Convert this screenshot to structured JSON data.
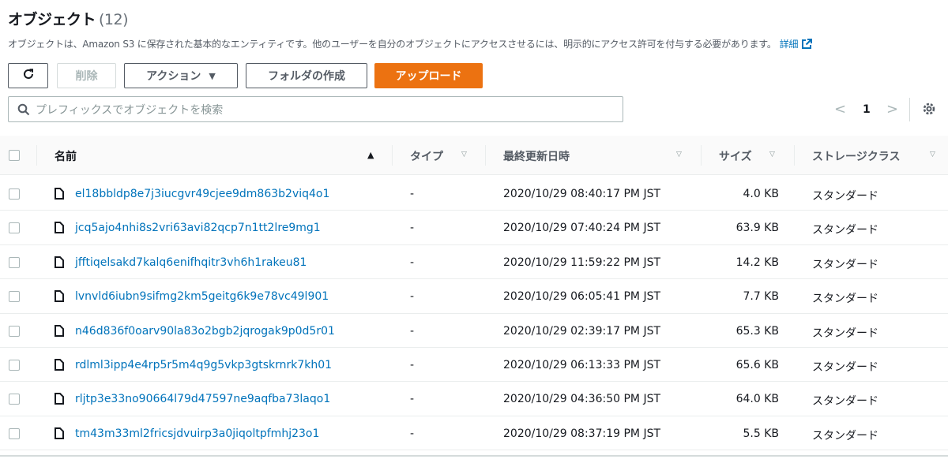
{
  "header": {
    "title": "オブジェクト",
    "count": "(12)",
    "description": "オブジェクトは、Amazon S3 に保存された基本的なエンティティです。他のユーザーを自分のオブジェクトにアクセスさせるには、明示的にアクセス許可を付与する必要があります。",
    "details_link": "詳細"
  },
  "toolbar": {
    "refresh_icon": "refresh-icon",
    "delete_label": "削除",
    "actions_label": "アクション",
    "create_folder_label": "フォルダの作成",
    "upload_label": "アップロード"
  },
  "search": {
    "placeholder": "プレフィックスでオブジェクトを検索"
  },
  "pagination": {
    "page": "1"
  },
  "table": {
    "columns": {
      "name": "名前",
      "type": "タイプ",
      "modified": "最終更新日時",
      "size": "サイズ",
      "storage_class": "ストレージクラス"
    },
    "rows": [
      {
        "name": "el18bbldp8e7j3iucgvr49cjee9dm863b2viq4o1",
        "type": "-",
        "modified": "2020/10/29 08:40:17 PM JST",
        "size": "4.0 KB",
        "storage_class": "スタンダード"
      },
      {
        "name": "jcq5ajo4nhi8s2vri63avi82qcp7n1tt2lre9mg1",
        "type": "-",
        "modified": "2020/10/29 07:40:24 PM JST",
        "size": "63.9 KB",
        "storage_class": "スタンダード"
      },
      {
        "name": "jfftiqelsakd7kalq6enifhqitr3vh6h1rakeu81",
        "type": "-",
        "modified": "2020/10/29 11:59:22 PM JST",
        "size": "14.2 KB",
        "storage_class": "スタンダード"
      },
      {
        "name": "lvnvld6iubn9sifmg2km5geitg6k9e78vc49l901",
        "type": "-",
        "modified": "2020/10/29 06:05:41 PM JST",
        "size": "7.7 KB",
        "storage_class": "スタンダード"
      },
      {
        "name": "n46d836f0oarv90la83o2bgb2jqrogak9p0d5r01",
        "type": "-",
        "modified": "2020/10/29 02:39:17 PM JST",
        "size": "65.3 KB",
        "storage_class": "スタンダード"
      },
      {
        "name": "rdlml3ipp4e4rp5r5m4q9g5vkp3gtskrnrk7kh01",
        "type": "-",
        "modified": "2020/10/29 06:13:33 PM JST",
        "size": "65.6 KB",
        "storage_class": "スタンダード"
      },
      {
        "name": "rljtp3e33no90664l79d47597ne9aqfba73laqo1",
        "type": "-",
        "modified": "2020/10/29 04:36:50 PM JST",
        "size": "64.0 KB",
        "storage_class": "スタンダード"
      },
      {
        "name": "tm43m33ml2fricsjdvuirp3a0jiqoltpfmhj23o1",
        "type": "-",
        "modified": "2020/10/29 08:37:19 PM JST",
        "size": "5.5 KB",
        "storage_class": "スタンダード"
      }
    ]
  },
  "colors": {
    "link": "#0073bb",
    "primary": "#ec7211",
    "text": "#16191f",
    "muted": "#545b64"
  }
}
